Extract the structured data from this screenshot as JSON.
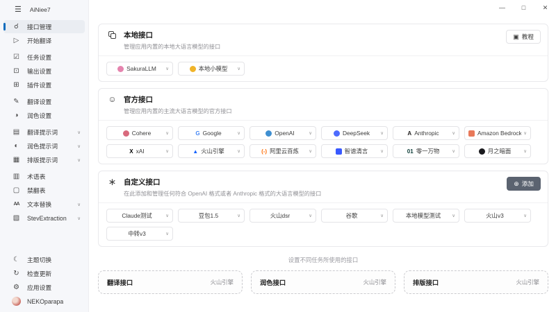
{
  "colors": {
    "accent": "#0f6cbd",
    "add_button": "#5b6370",
    "sidebar_bg": "#f6f7fa"
  },
  "titlebar": {
    "title": "AiNiee7",
    "minimize": "—",
    "maximize": "□",
    "close": "✕"
  },
  "sidebar": {
    "groups": [
      {
        "items": [
          {
            "id": "interface-management",
            "label": "接口管理",
            "icon": "link-icon",
            "active": true
          },
          {
            "id": "start-translate",
            "label": "开始翻译",
            "icon": "play-icon"
          }
        ]
      },
      {
        "items": [
          {
            "id": "task-settings",
            "label": "任务设置",
            "icon": "tasks-icon"
          },
          {
            "id": "output-settings",
            "label": "输出设置",
            "icon": "output-icon"
          },
          {
            "id": "plugin-settings",
            "label": "插件设置",
            "icon": "plugin-icon"
          }
        ]
      },
      {
        "items": [
          {
            "id": "translate-settings",
            "label": "翻译设置",
            "icon": "translate-icon"
          },
          {
            "id": "polish-settings",
            "label": "润色设置",
            "icon": "polish-icon"
          }
        ]
      },
      {
        "items": [
          {
            "id": "translate-prompts",
            "label": "翻译提示词",
            "icon": "translate-prompt-icon",
            "chevron": "∨"
          },
          {
            "id": "polish-prompts",
            "label": "润色提示词",
            "icon": "polish-prompt-icon",
            "chevron": "∨"
          },
          {
            "id": "layout-prompts",
            "label": "排版提示词",
            "icon": "layout-prompt-icon",
            "chevron": "∨"
          }
        ]
      },
      {
        "items": [
          {
            "id": "glossary",
            "label": "术语表",
            "icon": "glossary-icon"
          },
          {
            "id": "no-translate-list",
            "label": "禁翻表",
            "icon": "no-translate-icon"
          },
          {
            "id": "text-replace",
            "label": "文本替换",
            "icon": "text-replace-icon",
            "chevron": "∨"
          },
          {
            "id": "stev-extraction",
            "label": "StevExtraction",
            "icon": "folder-icon",
            "chevron": "∨"
          }
        ]
      }
    ],
    "footer": [
      {
        "id": "theme-toggle",
        "label": "主题切换",
        "icon": "moon-icon"
      },
      {
        "id": "check-update",
        "label": "检查更新",
        "icon": "update-icon"
      },
      {
        "id": "app-settings",
        "label": "应用设置",
        "icon": "gear-icon"
      },
      {
        "id": "user-nekoparapa",
        "label": "NEKOparapa",
        "icon": "avatar"
      }
    ]
  },
  "main": {
    "local_section": {
      "title": "本地接口",
      "subtitle": "管理应用内置的本地大语言模型的接口",
      "tutorial_button": "教程",
      "interfaces": [
        {
          "id": "sakurallm",
          "name": "SakuraLLM",
          "icon_shape": "circle",
          "icon_color": "#e584ae"
        },
        {
          "id": "local-small-model",
          "name": "本地小模型",
          "icon_shape": "circle",
          "icon_color": "#f0b429"
        }
      ]
    },
    "official_section": {
      "title": "官方接口",
      "subtitle": "管理应用内置的主流大语言模型的官方接口",
      "interfaces": [
        {
          "id": "cohere",
          "name": "Cohere",
          "icon_shape": "circle",
          "icon_color": "#d86a7d"
        },
        {
          "id": "google",
          "name": "Google",
          "icon_shape": "glyph",
          "icon_glyph": "G",
          "icon_color": "#4285f4"
        },
        {
          "id": "openai",
          "name": "OpenAI",
          "icon_shape": "circle",
          "icon_color": "#3f8fd1"
        },
        {
          "id": "deepseek",
          "name": "DeepSeek",
          "icon_shape": "circle",
          "icon_color": "#4d6bfe"
        },
        {
          "id": "anthropic",
          "name": "Anthropic",
          "icon_shape": "glyph",
          "icon_glyph": "A",
          "icon_color": "#1f1e1d"
        },
        {
          "id": "amazon-bedrock",
          "name": "Amazon Bedrock",
          "icon_shape": "square",
          "icon_color": "#e8795a"
        },
        {
          "id": "xai",
          "name": "xAI",
          "icon_shape": "glyph",
          "icon_glyph": "X",
          "icon_color": "#000000"
        },
        {
          "id": "volcano-engine",
          "name": "火山引擎",
          "icon_shape": "glyph",
          "icon_glyph": "▲",
          "icon_color": "#1664ff"
        },
        {
          "id": "aliyun-bailian",
          "name": "阿里云百炼",
          "icon_shape": "glyph",
          "icon_glyph": "(-)",
          "icon_color": "#ff6a00"
        },
        {
          "id": "zhipu",
          "name": "智谱清言",
          "icon_shape": "square",
          "icon_color": "#3859ff"
        },
        {
          "id": "01ai",
          "name": "零一万物",
          "icon_shape": "glyph",
          "icon_glyph": "01",
          "icon_color": "#0b3b36"
        },
        {
          "id": "moonshot",
          "name": "月之暗面",
          "icon_shape": "circle",
          "icon_color": "#1a1a1e"
        }
      ]
    },
    "custom_section": {
      "title": "自定义接口",
      "subtitle": "在此添加和管理任何符合 OpenAI 格式或者 Anthropic 格式的大语言模型的接口",
      "add_button": "添加",
      "interfaces": [
        {
          "id": "claude-test",
          "name": "Claude测试"
        },
        {
          "id": "doubao-1-5",
          "name": "豆包1.5"
        },
        {
          "id": "volcano-dsr",
          "name": "火山dsr"
        },
        {
          "id": "guge",
          "name": "谷歌"
        },
        {
          "id": "local-model-test",
          "name": "本地模型测试"
        },
        {
          "id": "volcano-v3",
          "name": "火山v3"
        },
        {
          "id": "zhongzhuan-v3",
          "name": "中转v3"
        }
      ]
    },
    "task_section": {
      "caption": "设置不同任务所使用的接口",
      "cards": [
        {
          "id": "translate-interface",
          "label": "翻译接口",
          "value": "火山引擎"
        },
        {
          "id": "polish-interface",
          "label": "润色接口",
          "value": "火山引擎"
        },
        {
          "id": "layout-interface",
          "label": "排版接口",
          "value": "火山引擎"
        }
      ]
    }
  }
}
